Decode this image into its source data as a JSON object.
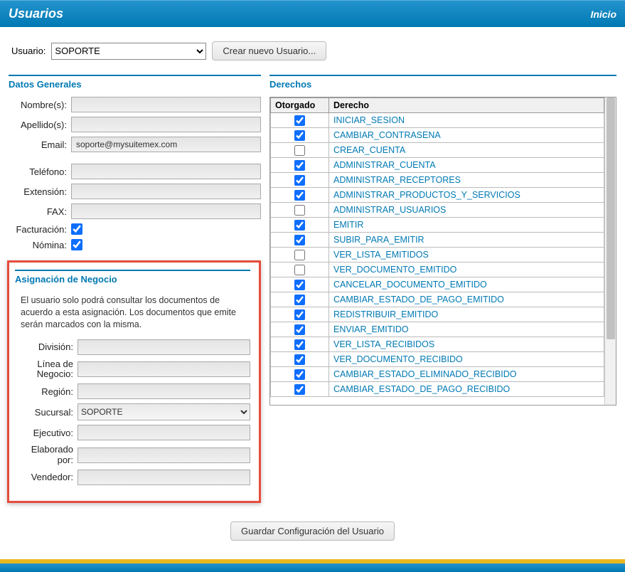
{
  "header": {
    "title": "Usuarios",
    "home": "Inicio"
  },
  "top": {
    "user_label": "Usuario:",
    "user_options": [
      "SOPORTE"
    ],
    "user_selected": "SOPORTE",
    "create_btn": "Crear nuevo Usuario..."
  },
  "general": {
    "title": "Datos Generales",
    "labels": {
      "nombre": "Nombre(s):",
      "apellido": "Apellido(s):",
      "email": "Email:",
      "telefono": "Teléfono:",
      "extension": "Extensión:",
      "fax": "FAX:",
      "facturacion": "Facturación:",
      "nomina": "Nómina:"
    },
    "values": {
      "nombre": "",
      "apellido": "",
      "email": "soporte@mysuitemex.com",
      "telefono": "",
      "extension": "",
      "fax": "",
      "facturacion": true,
      "nomina": true
    }
  },
  "asignacion": {
    "title": "Asignación de Negocio",
    "helper": "El usuario solo podrá consultar los documentos de acuerdo a esta asignación. Los documentos que emite serán marcados con la misma.",
    "labels": {
      "division": "División:",
      "linea": "Línea de Negocio:",
      "region": "Región:",
      "sucursal": "Sucursal:",
      "ejecutivo": "Ejecutivo:",
      "elaborado": "Elaborado por:",
      "vendedor": "Vendedor:"
    },
    "values": {
      "division": "",
      "linea": "",
      "region": "",
      "sucursal_selected": "SOPORTE",
      "sucursal_options": [
        "SOPORTE"
      ],
      "ejecutivo": "",
      "elaborado": "",
      "vendedor": ""
    }
  },
  "rights": {
    "title": "Derechos",
    "cols": {
      "otorgado": "Otorgado",
      "derecho": "Derecho"
    },
    "rows": [
      {
        "checked": true,
        "name": "INICIAR_SESION"
      },
      {
        "checked": true,
        "name": "CAMBIAR_CONTRASENA"
      },
      {
        "checked": false,
        "name": "CREAR_CUENTA"
      },
      {
        "checked": true,
        "name": "ADMINISTRAR_CUENTA"
      },
      {
        "checked": true,
        "name": "ADMINISTRAR_RECEPTORES"
      },
      {
        "checked": true,
        "name": "ADMINISTRAR_PRODUCTOS_Y_SERVICIOS"
      },
      {
        "checked": false,
        "name": "ADMINISTRAR_USUARIOS"
      },
      {
        "checked": true,
        "name": "EMITIR"
      },
      {
        "checked": true,
        "name": "SUBIR_PARA_EMITIR"
      },
      {
        "checked": false,
        "name": "VER_LISTA_EMITIDOS"
      },
      {
        "checked": false,
        "name": "VER_DOCUMENTO_EMITIDO"
      },
      {
        "checked": true,
        "name": "CANCELAR_DOCUMENTO_EMITIDO"
      },
      {
        "checked": true,
        "name": "CAMBIAR_ESTADO_DE_PAGO_EMITIDO"
      },
      {
        "checked": true,
        "name": "REDISTRIBUIR_EMITIDO"
      },
      {
        "checked": true,
        "name": "ENVIAR_EMITIDO"
      },
      {
        "checked": true,
        "name": "VER_LISTA_RECIBIDOS"
      },
      {
        "checked": true,
        "name": "VER_DOCUMENTO_RECIBIDO"
      },
      {
        "checked": true,
        "name": "CAMBIAR_ESTADO_ELIMINADO_RECIBIDO"
      },
      {
        "checked": true,
        "name": "CAMBIAR_ESTADO_DE_PAGO_RECIBIDO"
      }
    ]
  },
  "save_btn": "Guardar Configuración del Usuario"
}
